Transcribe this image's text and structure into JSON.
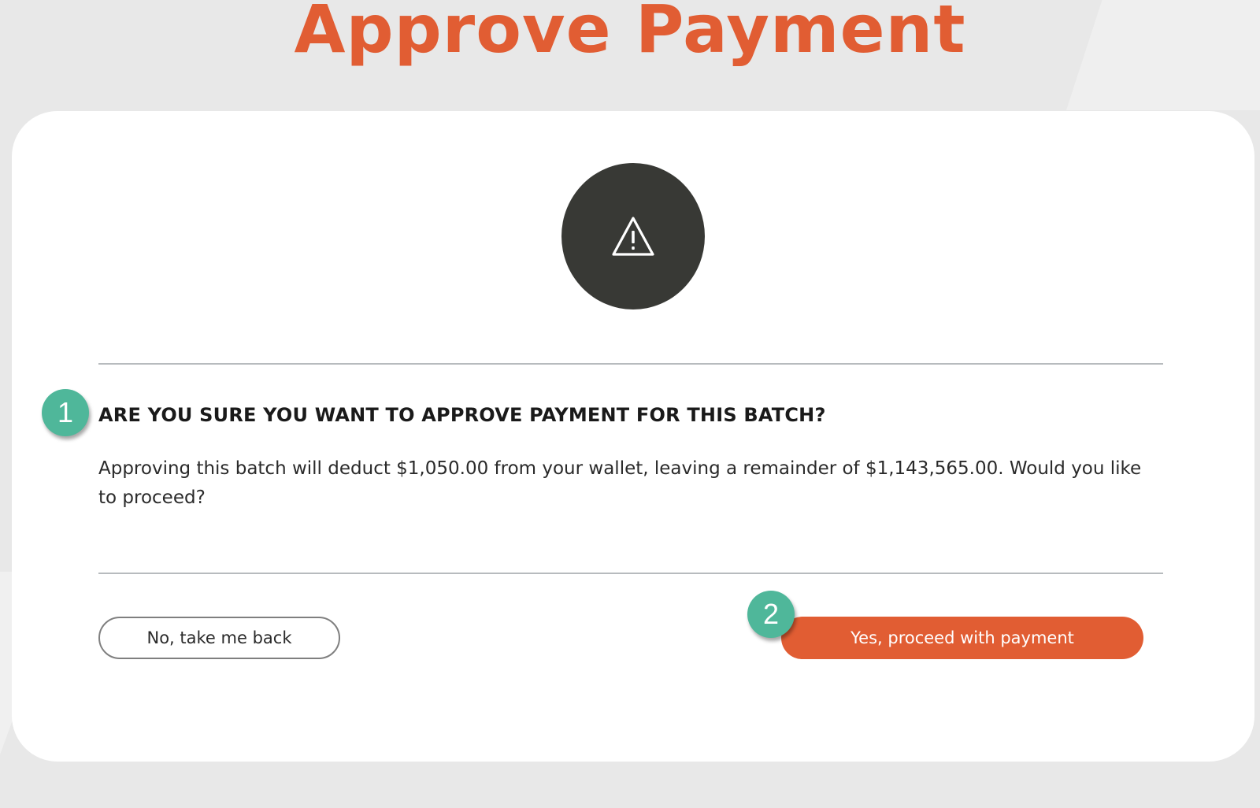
{
  "header": {
    "title": "Approve Payment"
  },
  "dialog": {
    "warning_icon": "warning-triangle-icon",
    "question": "ARE YOU SURE YOU WANT TO APPROVE PAYMENT FOR THIS BATCH?",
    "message": "Approving this batch will deduct $1,050.00  from your wallet, leaving a remainder of  $1,143,565.00. Would you like to proceed?",
    "cancel_label": "No, take me back",
    "confirm_label": "Yes, proceed with payment"
  },
  "annotations": {
    "step_1": "1",
    "step_2": "2"
  },
  "colors": {
    "accent": "#e15d33",
    "badge": "#4fb79a",
    "icon_circle": "#383935",
    "background": "#e8e8e8"
  }
}
